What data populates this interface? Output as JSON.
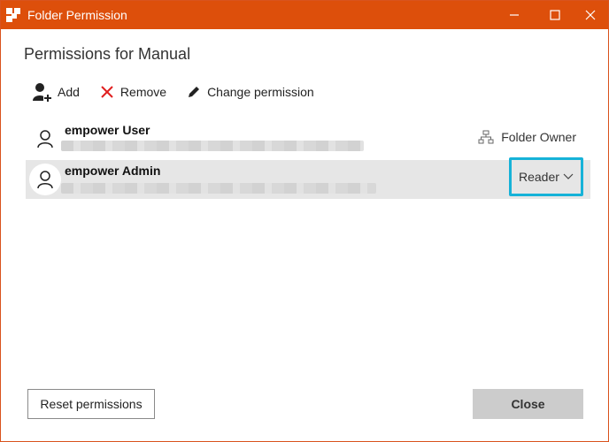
{
  "window": {
    "title": "Folder Permission",
    "accent": "#dd4f0b"
  },
  "heading": "Permissions for Manual",
  "toolbar": {
    "add_label": "Add",
    "remove_label": "Remove",
    "change_label": "Change permission"
  },
  "users": [
    {
      "name": "empower User",
      "role": "Folder Owner"
    },
    {
      "name": "empower Admin",
      "permission": "Reader"
    }
  ],
  "footer": {
    "reset_label": "Reset permissions",
    "close_label": "Close"
  },
  "colors": {
    "selection_border": "#16b2d8",
    "remove_red": "#e02020"
  }
}
